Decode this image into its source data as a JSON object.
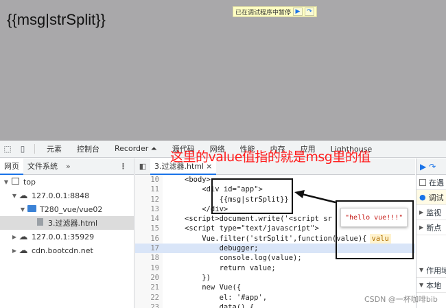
{
  "page": {
    "template_text": "{{msg|strSplit}}",
    "paused_banner": {
      "text": "已在调试程序中暂停",
      "resume_icon": "resume-icon",
      "step_over_icon": "step-over-icon"
    }
  },
  "annotation": {
    "text_primary": "这里的value值指的就是msg里的值",
    "color": "#ff1e1e"
  },
  "devtools": {
    "toolbar": {
      "tabs": [
        "元素",
        "控制台",
        "Recorder ⏶",
        "源代码",
        "网络",
        "性能",
        "内存",
        "应用",
        "Lighthouse"
      ]
    },
    "navigator": {
      "tabs": [
        "网页",
        "文件系统"
      ],
      "more": "»",
      "menu": "⋮",
      "tree": [
        {
          "label": "top",
          "indent": 0,
          "arrow": "▼",
          "icon": "frame-icon"
        },
        {
          "label": "127.0.0.1:8848",
          "indent": 1,
          "arrow": "▼",
          "icon": "cloud-icon"
        },
        {
          "label": "T280_vue/vue02",
          "indent": 2,
          "arrow": "▼",
          "icon": "folder-icon"
        },
        {
          "label": "3.过滤器.html",
          "indent": 3,
          "arrow": "",
          "icon": "file-icon"
        },
        {
          "label": "127.0.0.1:35929",
          "indent": 1,
          "arrow": "▶",
          "icon": "cloud-icon"
        },
        {
          "label": "cdn.bootcdn.net",
          "indent": 1,
          "arrow": "▶",
          "icon": "cloud-icon"
        }
      ]
    },
    "editor": {
      "file_tab": "3.过滤器.html",
      "close": "×",
      "lines": [
        {
          "n": "10",
          "code": "<body>"
        },
        {
          "n": "11",
          "code": "    <div id=\"app\">"
        },
        {
          "n": "12",
          "code": "        {{msg|strSplit}}"
        },
        {
          "n": "13",
          "code": "    </div>"
        },
        {
          "n": "14",
          "code": "<script>document.write('<script sr"
        },
        {
          "n": "15",
          "code": "<script type=\"text/javascript\">"
        },
        {
          "n": "16",
          "code": "    Vue.filter('strSplit',function(value){"
        },
        {
          "n": "17",
          "code": "        debugger;"
        },
        {
          "n": "18",
          "code": "        console.log(value);"
        },
        {
          "n": "19",
          "code": "        return value;"
        },
        {
          "n": "20",
          "code": "    })"
        },
        {
          "n": "21",
          "code": "    new Vue({"
        },
        {
          "n": "22",
          "code": "        el: '#app',"
        },
        {
          "n": "23",
          "code": "        data() {"
        }
      ],
      "inline_hint": "valu",
      "popover_value": "\"hello vue!!!\""
    },
    "sidebar": {
      "rows": [
        "在遇",
        "调试",
        "监视",
        "断点",
        "作用域",
        "本地"
      ]
    }
  },
  "watermark": "CSDN @一杯咖啡bib"
}
